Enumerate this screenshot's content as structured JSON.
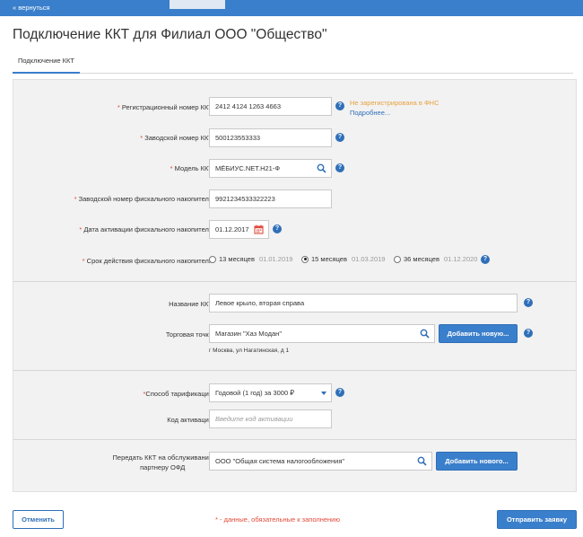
{
  "topbar": {
    "back_label": "« вернуться"
  },
  "page_title": "Подключение ККТ для Филиал ООО \"Общество\"",
  "tabs": [
    {
      "label": "Подключение ККТ"
    }
  ],
  "form": {
    "reg_number": {
      "label": "Регистрационный номер ККТ",
      "value": "2412 4124 1263 4663",
      "status": "Не зарегистрирована в ФНС",
      "details_link": "Подробнее..."
    },
    "serial_number": {
      "label": "Заводской номер ККТ",
      "value": "500123553333"
    },
    "model": {
      "label": "Модель ККТ",
      "value": "МЁБИУС.NET.Н21-Ф"
    },
    "fn_serial": {
      "label": "Заводской номер фискального накопителя",
      "value": "9921234533322223"
    },
    "fn_activation_date": {
      "label": "Дата активации фискального накопителя",
      "value": "01.12.2017"
    },
    "fn_validity": {
      "label": "Срок действия фискального накопителя",
      "options": [
        {
          "label": "13 месяцев",
          "date": "01.01.2019",
          "selected": false
        },
        {
          "label": "15 месяцев",
          "date": "01.03.2019",
          "selected": true
        },
        {
          "label": "36 месяцев",
          "date": "01.12.2020",
          "selected": false
        }
      ]
    },
    "kkt_name": {
      "label": "Название ККТ",
      "value": "Левое крыло, вторая справа"
    },
    "store": {
      "label": "Торговая точка",
      "value": "Магазин \"Хаз Модан\"",
      "address": "г Москва, ул Нагатинская, д 1",
      "add_button": "Добавить новую..."
    },
    "tariff": {
      "label": "Способ тарификации",
      "value": "Годовой (1 год) за 3000 ₽"
    },
    "activation_code": {
      "label": "Код активации",
      "placeholder": "Введите код активации"
    },
    "ofd_partner": {
      "label_line1": "Передать ККТ на обслуживание",
      "label_line2": "партнеру ОФД",
      "value": "ООО \"Общая система налогообложения\"",
      "add_button": "Добавить нового..."
    }
  },
  "help_symbol": "?",
  "required_marker": "*",
  "footer": {
    "cancel_label": "Отменить",
    "required_note": "* - данные, обязательные к заполнению",
    "submit_label": "Отправить заявку"
  },
  "colors": {
    "topbar": "#3a7fcb",
    "accent": "#2e6fb8",
    "warning": "#e7a23f",
    "required": "#e04a3a",
    "panel": "#f2f2f2"
  },
  "icons": {
    "search": "search-icon",
    "calendar": "calendar-icon",
    "help": "help-icon",
    "dropdown": "chevron-down-icon"
  }
}
